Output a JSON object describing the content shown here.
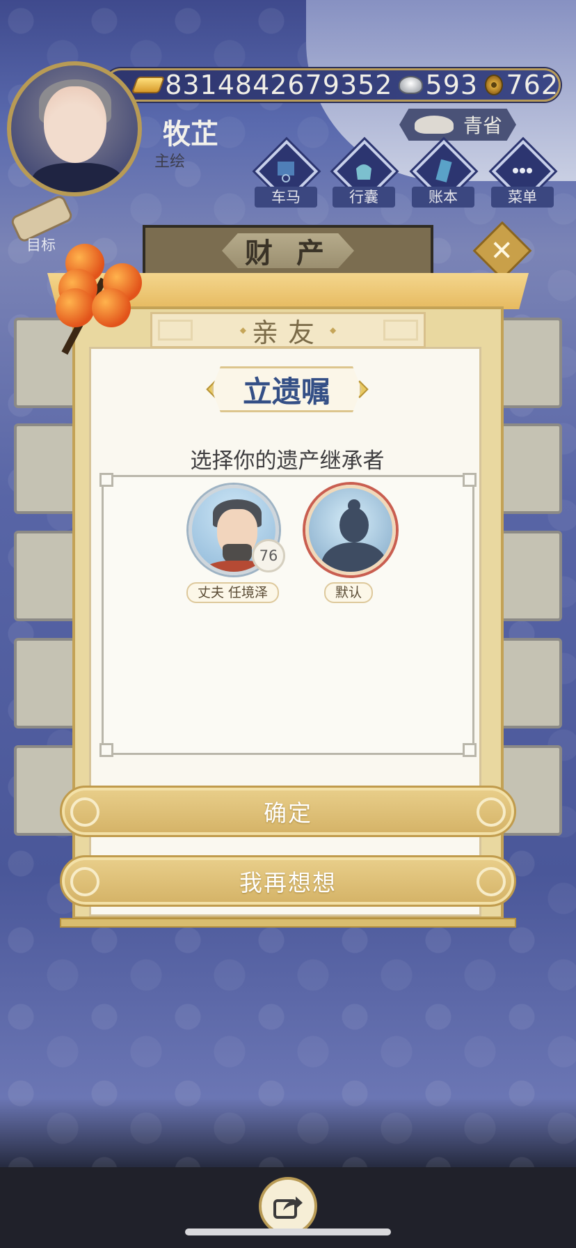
{
  "player": {
    "name": "牧芷",
    "title": "主绘"
  },
  "currency": {
    "gold": "8314842679352",
    "silver": "593",
    "copper": "762"
  },
  "location": "青省",
  "nav": {
    "carriage": "车马",
    "baggage": "行囊",
    "ledger": "账本",
    "menu": "菜单",
    "goal": "目标"
  },
  "banner": {
    "title": "财 产"
  },
  "dialog": {
    "tab": "亲友",
    "title": "立遗嘱",
    "prompt": "选择你的遗产继承者",
    "heirs": [
      {
        "name": "丈夫 任境泽",
        "age": "76"
      },
      {
        "name": "默认"
      }
    ],
    "confirm": "确定",
    "reconsider": "我再想想"
  },
  "colors": {
    "accent_gold": "#d4b266",
    "title_blue": "#344f86",
    "background_blue": "#4a5799"
  }
}
